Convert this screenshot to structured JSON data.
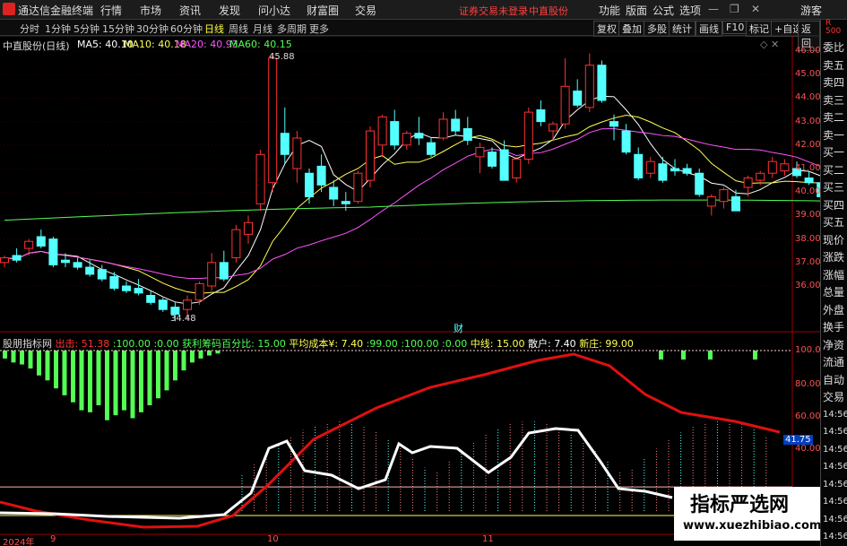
{
  "titlebar": {
    "app_name": "通达信金融终端",
    "menus": [
      "行情",
      "市场",
      "资讯",
      "发现",
      "问小达",
      "财富圈",
      "交易"
    ],
    "notice": "证券交易未登录",
    "stock_name_red": "中直股份",
    "right_buttons": [
      "功能",
      "版面",
      "公式",
      "选项"
    ],
    "guest": "游客"
  },
  "toolbar": {
    "periods": [
      "分时",
      "1分钟",
      "5分钟",
      "15分钟",
      "30分钟",
      "60分钟",
      "日线",
      "周线",
      "月线",
      "多周期",
      "更多"
    ],
    "active_period": "日线",
    "right_tools": [
      "复权",
      "叠加",
      "多股",
      "统计",
      "画线",
      "F10",
      "标记",
      "+自选",
      "返回"
    ]
  },
  "chart_header": {
    "stock": "中直股份(日线)",
    "ma5": "MA5: 40.10",
    "ma10": "MA10: 40.18",
    "ma20": "MA20: 40.93",
    "ma60": "MA60: 40.15"
  },
  "price_axis": [
    "46.00",
    "45.00",
    "44.00",
    "43.00",
    "42.00",
    "41.00",
    "40.00",
    "39.00",
    "38.00",
    "37.00",
    "36.00"
  ],
  "annotations": {
    "high": "45.88",
    "low": "34.48",
    "cai": "财"
  },
  "indicator_header": {
    "name": "股朋指标网",
    "chu_label": "出击:",
    "chu_value": "51.38",
    "v1": "100.00",
    "v2": "0.00",
    "huoli_label": "获利筹码百分比:",
    "huoli_value": "15.00",
    "pingjun_label": "平均成本¥:",
    "pingjun_value": "7.40",
    "v3": "99.00",
    "v4": "100.00",
    "v5": "0.00",
    "zhongxian_label": "中线:",
    "zhongxian_value": "15.00",
    "sanhu_label": "散户:",
    "sanhu_value": "7.40",
    "xinzhuang_label": "新庄:",
    "xinzhuang_value": "99.00"
  },
  "indicator_axis": [
    "100.0",
    "80.00",
    "60.00",
    "40.00"
  ],
  "indicator_value_box": "41.75",
  "date_labels": {
    "year": "2024年",
    "m9": "9",
    "m10": "10",
    "m11": "11"
  },
  "side_panel": [
    "委比",
    "卖五",
    "卖四",
    "卖三",
    "卖二",
    "卖一",
    "买一",
    "买二",
    "买三",
    "买四",
    "买五",
    "现价",
    "涨跌",
    "涨幅",
    "总量",
    "外盘",
    "换手",
    "净资",
    "流通",
    "自动",
    "交易",
    "14:56",
    "14:56",
    "14:56",
    "14:56",
    "14:56",
    "14:56",
    "14:56",
    "14:56"
  ],
  "side_top": "R 500",
  "watermark": {
    "line1": "指标严选网",
    "line2": "www.xuezhibiao.com"
  },
  "colors": {
    "up": "#ff3232",
    "down": "#54ffff",
    "ma5": "#ffffff",
    "ma10": "#ffff54",
    "ma20": "#ff54ff",
    "ma60": "#54ff54"
  },
  "candles": [
    [
      37.0,
      37.3,
      36.8,
      37.2
    ],
    [
      37.3,
      37.6,
      37.0,
      37.1
    ],
    [
      37.6,
      38.0,
      37.3,
      37.9
    ],
    [
      38.1,
      38.4,
      37.6,
      37.7
    ],
    [
      38.0,
      38.1,
      36.8,
      36.9
    ],
    [
      37.1,
      37.4,
      36.8,
      37.0
    ],
    [
      37.0,
      37.2,
      36.7,
      36.8
    ],
    [
      36.8,
      37.1,
      36.4,
      36.5
    ],
    [
      36.7,
      36.9,
      36.2,
      36.3
    ],
    [
      36.4,
      36.6,
      35.8,
      35.9
    ],
    [
      36.0,
      36.2,
      35.7,
      35.8
    ],
    [
      35.9,
      36.3,
      35.6,
      35.7
    ],
    [
      35.6,
      35.8,
      35.2,
      35.3
    ],
    [
      35.4,
      35.5,
      34.9,
      35.0
    ],
    [
      35.1,
      35.3,
      34.5,
      34.8
    ],
    [
      35.0,
      35.6,
      34.6,
      35.4
    ],
    [
      35.4,
      36.2,
      35.2,
      36.1
    ],
    [
      36.0,
      37.4,
      35.8,
      37.0
    ],
    [
      37.0,
      37.5,
      36.2,
      36.3
    ],
    [
      37.2,
      38.6,
      37.0,
      38.4
    ],
    [
      38.2,
      39.0,
      37.8,
      38.7
    ],
    [
      39.5,
      41.8,
      39.2,
      41.6
    ],
    [
      40.4,
      45.9,
      40.0,
      45.7
    ],
    [
      42.5,
      43.6,
      41.2,
      41.6
    ],
    [
      41.0,
      42.6,
      40.4,
      42.3
    ],
    [
      40.8,
      41.0,
      39.5,
      39.8
    ],
    [
      41.1,
      41.6,
      40.0,
      40.3
    ],
    [
      40.2,
      40.5,
      39.4,
      39.7
    ],
    [
      39.6,
      40.0,
      39.2,
      39.5
    ],
    [
      39.6,
      40.9,
      39.5,
      40.8
    ],
    [
      40.5,
      42.8,
      40.2,
      42.6
    ],
    [
      42.0,
      43.3,
      41.5,
      43.2
    ],
    [
      43.0,
      43.5,
      41.8,
      42.0
    ],
    [
      42.0,
      42.6,
      41.8,
      42.5
    ],
    [
      42.5,
      43.2,
      42.0,
      42.3
    ],
    [
      42.1,
      42.3,
      41.5,
      41.6
    ],
    [
      42.3,
      43.4,
      42.2,
      43.1
    ],
    [
      43.1,
      43.5,
      42.4,
      42.6
    ],
    [
      42.7,
      43.2,
      42.0,
      42.2
    ],
    [
      41.5,
      42.1,
      40.8,
      41.9
    ],
    [
      41.7,
      41.9,
      41.0,
      41.1
    ],
    [
      41.8,
      42.2,
      40.5,
      40.5
    ],
    [
      40.6,
      41.5,
      40.4,
      41.4
    ],
    [
      41.4,
      43.6,
      41.2,
      43.4
    ],
    [
      43.5,
      43.9,
      42.8,
      43.0
    ],
    [
      42.6,
      43.0,
      42.2,
      42.9
    ],
    [
      42.9,
      45.7,
      42.7,
      44.5
    ],
    [
      44.3,
      44.8,
      43.6,
      43.7
    ],
    [
      43.6,
      45.9,
      43.4,
      45.4
    ],
    [
      45.4,
      45.6,
      43.8,
      43.9
    ],
    [
      43.0,
      43.3,
      42.2,
      42.8
    ],
    [
      42.6,
      42.9,
      41.6,
      41.7
    ],
    [
      41.6,
      41.9,
      40.5,
      40.6
    ],
    [
      40.8,
      41.5,
      40.6,
      41.3
    ],
    [
      41.2,
      41.5,
      40.4,
      40.5
    ],
    [
      41.0,
      41.4,
      40.7,
      40.9
    ],
    [
      41.0,
      41.2,
      40.7,
      40.8
    ],
    [
      40.8,
      41.0,
      39.8,
      39.9
    ],
    [
      39.4,
      39.9,
      39.0,
      39.8
    ],
    [
      39.6,
      40.2,
      39.3,
      40.1
    ],
    [
      39.8,
      40.1,
      39.2,
      39.2
    ],
    [
      40.2,
      40.7,
      39.8,
      40.6
    ],
    [
      40.5,
      40.9,
      40.3,
      40.8
    ],
    [
      40.8,
      41.5,
      40.6,
      41.3
    ],
    [
      40.9,
      41.4,
      40.7,
      41.2
    ],
    [
      41.0,
      41.3,
      40.6,
      40.7
    ],
    [
      40.6,
      40.9,
      40.3,
      40.4
    ],
    [
      40.4,
      40.6,
      39.6,
      39.8
    ],
    [
      39.7,
      40.2,
      39.6,
      40.1
    ],
    [
      39.9,
      40.4,
      39.8,
      40.2
    ]
  ]
}
